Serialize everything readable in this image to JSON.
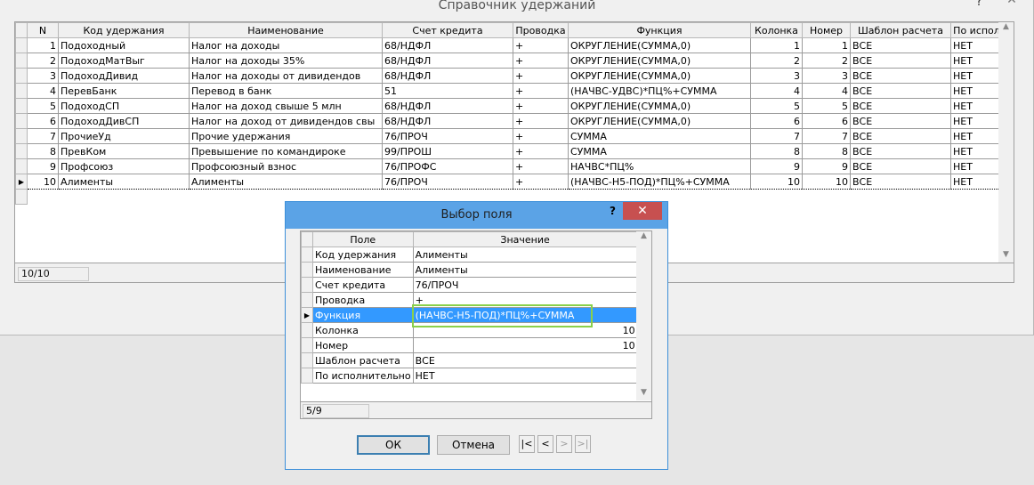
{
  "main_window": {
    "title": "Справочник удержаний",
    "help": "?",
    "close": "✕",
    "columns": [
      "N",
      "Код удержания",
      "Наименование",
      "Счет кредита",
      "Проводка",
      "Функция",
      "Колонка",
      "Номер",
      "Шаблон расчета",
      "По испол"
    ],
    "rows": [
      {
        "n": "1",
        "code": "Подоходный",
        "name": "Налог на доходы",
        "account": "68/НДФЛ",
        "posting": "+",
        "func": "ОКРУГЛЕНИЕ(СУММА,0)",
        "col": "1",
        "num": "1",
        "tmpl": "ВСЕ",
        "exec": "НЕТ"
      },
      {
        "n": "2",
        "code": "ПодоходМатВыг",
        "name": "Налог на доходы 35%",
        "account": "68/НДФЛ",
        "posting": "+",
        "func": "ОКРУГЛЕНИЕ(СУММА,0)",
        "col": "2",
        "num": "2",
        "tmpl": "ВСЕ",
        "exec": "НЕТ"
      },
      {
        "n": "3",
        "code": "ПодоходДивид",
        "name": "Налог на доходы от дивидендов",
        "account": "68/НДФЛ",
        "posting": "+",
        "func": "ОКРУГЛЕНИЕ(СУММА,0)",
        "col": "3",
        "num": "3",
        "tmpl": "ВСЕ",
        "exec": "НЕТ"
      },
      {
        "n": "4",
        "code": "ПеревБанк",
        "name": "Перевод в банк",
        "account": "51",
        "posting": "+",
        "func": "(НАЧВС-УДВС)*ПЦ%+СУММА",
        "col": "4",
        "num": "4",
        "tmpl": "ВСЕ",
        "exec": "НЕТ"
      },
      {
        "n": "5",
        "code": "ПодоходСП",
        "name": "Налог на доход свыше 5 млн",
        "account": "68/НДФЛ",
        "posting": "+",
        "func": "ОКРУГЛЕНИЕ(СУММА,0)",
        "col": "5",
        "num": "5",
        "tmpl": "ВСЕ",
        "exec": "НЕТ"
      },
      {
        "n": "6",
        "code": "ПодоходДивСП",
        "name": "Налог на доход от дивидендов свы",
        "account": "68/НДФЛ",
        "posting": "+",
        "func": "ОКРУГЛЕНИЕ(СУММА,0)",
        "col": "6",
        "num": "6",
        "tmpl": "ВСЕ",
        "exec": "НЕТ"
      },
      {
        "n": "7",
        "code": "ПрочиеУд",
        "name": "Прочие удержания",
        "account": "76/ПРОЧ",
        "posting": "+",
        "func": "СУММА",
        "col": "7",
        "num": "7",
        "tmpl": "ВСЕ",
        "exec": "НЕТ"
      },
      {
        "n": "8",
        "code": "ПревКом",
        "name": "Превышение по командироке",
        "account": "99/ПРОШ",
        "posting": "+",
        "func": "СУММА",
        "col": "8",
        "num": "8",
        "tmpl": "ВСЕ",
        "exec": "НЕТ"
      },
      {
        "n": "9",
        "code": "Профсоюз",
        "name": "Профсоюзный взнос",
        "account": "76/ПРОФС",
        "posting": "+",
        "func": "НАЧВС*ПЦ%",
        "col": "9",
        "num": "9",
        "tmpl": "ВСЕ",
        "exec": "НЕТ"
      },
      {
        "n": "10",
        "code": "Алименты",
        "name": "Алименты",
        "account": "76/ПРОЧ",
        "posting": "+",
        "func": "(НАЧВС-Н5-ПОД)*ПЦ%+СУММА",
        "col": "10",
        "num": "10",
        "tmpl": "ВСЕ",
        "exec": "НЕТ"
      }
    ],
    "record_position": "10/10"
  },
  "dialog": {
    "title": "Выбор поля",
    "help": "?",
    "close": "✕",
    "columns": [
      "Поле",
      "Значение"
    ],
    "rows": [
      {
        "field": "Код удержания",
        "value": "Алименты",
        "align": "left"
      },
      {
        "field": "Наименование",
        "value": "Алименты",
        "align": "left"
      },
      {
        "field": "Счет кредита",
        "value": "76/ПРОЧ",
        "align": "left"
      },
      {
        "field": "Проводка",
        "value": "+",
        "align": "left"
      },
      {
        "field": "Функция",
        "value": "(НАЧВС-Н5-ПОД)*ПЦ%+СУММА",
        "align": "left"
      },
      {
        "field": "Колонка",
        "value": "10",
        "align": "right"
      },
      {
        "field": "Номер",
        "value": "10",
        "align": "right"
      },
      {
        "field": "Шаблон расчета",
        "value": "ВСЕ",
        "align": "left"
      },
      {
        "field": "По исполнительно",
        "value": "НЕТ",
        "align": "left"
      }
    ],
    "selected_index": 4,
    "record_position": "5/9",
    "ok_label": "ОК",
    "cancel_label": "Отмена",
    "nav": {
      "first": "|<",
      "prev": "<",
      "next": ">",
      "last": ">|"
    }
  }
}
